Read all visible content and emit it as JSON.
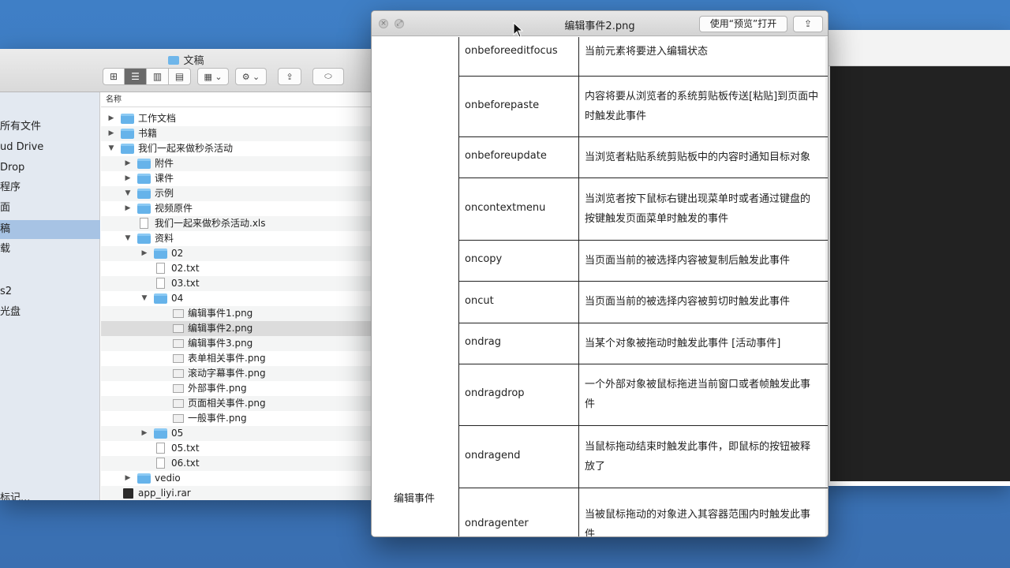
{
  "finder": {
    "title": "文稿",
    "column_header": "名称",
    "sidebar": [
      {
        "label": "所有文件",
        "prefix_icon": true
      },
      {
        "label": "ud Drive"
      },
      {
        "label": "Drop"
      },
      {
        "label": "程序",
        "prefix_icon": true
      },
      {
        "label": "面"
      },
      {
        "label": "稿",
        "selected": true
      },
      {
        "label": "载"
      },
      {
        "label": ""
      },
      {
        "label": "s2"
      },
      {
        "label": "光盘",
        "prefix_icon": true
      },
      {
        "label": ""
      },
      {
        "label": ""
      },
      {
        "label": ""
      },
      {
        "label": ""
      },
      {
        "label": ""
      },
      {
        "label": ""
      },
      {
        "label": ""
      },
      {
        "label": "标记..."
      }
    ],
    "files": [
      {
        "name": "工作文档",
        "kind": "folder",
        "depth": 0,
        "tri": "▶"
      },
      {
        "name": "书籍",
        "kind": "folder",
        "depth": 0,
        "tri": "▶"
      },
      {
        "name": "我们一起来做秒杀活动",
        "kind": "folder",
        "depth": 0,
        "tri": "▼"
      },
      {
        "name": "附件",
        "kind": "folder",
        "depth": 1,
        "tri": "▶"
      },
      {
        "name": "课件",
        "kind": "folder",
        "depth": 1,
        "tri": "▶"
      },
      {
        "name": "示例",
        "kind": "folder",
        "depth": 1,
        "tri": "▼"
      },
      {
        "name": "视频原件",
        "kind": "folder",
        "depth": 1,
        "tri": "▶"
      },
      {
        "name": "我们一起来做秒杀活动.xls",
        "kind": "file",
        "depth": 1,
        "tri": ""
      },
      {
        "name": "资料",
        "kind": "folder",
        "depth": 1,
        "tri": "▼"
      },
      {
        "name": "02",
        "kind": "folder",
        "depth": 2,
        "tri": "▶"
      },
      {
        "name": "02.txt",
        "kind": "file",
        "depth": 2,
        "tri": ""
      },
      {
        "name": "03.txt",
        "kind": "file",
        "depth": 2,
        "tri": ""
      },
      {
        "name": "04",
        "kind": "folder",
        "depth": 2,
        "tri": "▼"
      },
      {
        "name": "编辑事件1.png",
        "kind": "image",
        "depth": 3,
        "tri": ""
      },
      {
        "name": "编辑事件2.png",
        "kind": "image",
        "depth": 3,
        "tri": "",
        "selected": true
      },
      {
        "name": "编辑事件3.png",
        "kind": "image",
        "depth": 3,
        "tri": ""
      },
      {
        "name": "表单相关事件.png",
        "kind": "image",
        "depth": 3,
        "tri": ""
      },
      {
        "name": "滚动字幕事件.png",
        "kind": "image",
        "depth": 3,
        "tri": ""
      },
      {
        "name": "外部事件.png",
        "kind": "image",
        "depth": 3,
        "tri": ""
      },
      {
        "name": "页面相关事件.png",
        "kind": "image",
        "depth": 3,
        "tri": ""
      },
      {
        "name": "一般事件.png",
        "kind": "image",
        "depth": 3,
        "tri": ""
      },
      {
        "name": "05",
        "kind": "folder",
        "depth": 2,
        "tri": "▶"
      },
      {
        "name": "05.txt",
        "kind": "file",
        "depth": 2,
        "tri": ""
      },
      {
        "name": "06.txt",
        "kind": "file",
        "depth": 2,
        "tri": ""
      },
      {
        "name": "vedio",
        "kind": "folder",
        "depth": 1,
        "tri": "▶"
      },
      {
        "name": "app_liyi.rar",
        "kind": "archive",
        "depth": 0,
        "tri": ""
      }
    ]
  },
  "preview": {
    "title": "编辑事件2.png",
    "open_button": "使用“预览”打开",
    "share_icon": "share-icon",
    "category": "编辑事件",
    "rows": [
      {
        "name": "onbeforeeditfocus",
        "desc": [
          "当前元素将要进入编辑状态"
        ]
      },
      {
        "name": "onbeforepaste",
        "desc": [
          "内容将要从浏览者的系统剪贴板传送[粘贴]到页面中",
          "时触发此事件"
        ]
      },
      {
        "name": "onbeforeupdate",
        "desc": [
          "当浏览者粘贴系统剪贴板中的内容时通知目标对象"
        ]
      },
      {
        "name": "oncontextmenu",
        "desc": [
          "当浏览者按下鼠标右键出现菜单时或者通过键盘的",
          "按键触发页面菜单时触发的事件"
        ]
      },
      {
        "name": "oncopy",
        "desc": [
          "当页面当前的被选择内容被复制后触发此事件"
        ]
      },
      {
        "name": "oncut",
        "desc": [
          "当页面当前的被选择内容被剪切时触发此事件"
        ]
      },
      {
        "name": "ondrag",
        "desc": [
          "当某个对象被拖动时触发此事件 [活动事件]"
        ]
      },
      {
        "name": "ondragdrop",
        "desc": [
          "一个外部对象被鼠标拖进当前窗口或者帧触发此事",
          "件"
        ]
      },
      {
        "name": "ondragend",
        "desc": [
          "当鼠标拖动结束时触发此事件，即鼠标的按钮被释",
          "放了"
        ]
      },
      {
        "name": "ondragenter",
        "desc": [
          "当被鼠标拖动的对象进入其容器范围内时触发此事",
          "件"
        ]
      }
    ]
  }
}
